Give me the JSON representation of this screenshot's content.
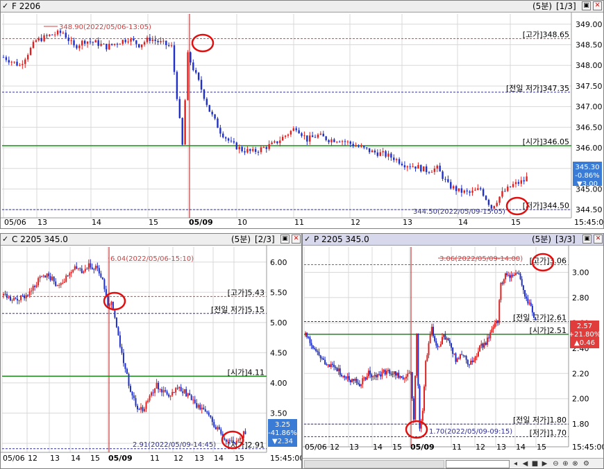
{
  "panels": [
    {
      "id": "F",
      "title": "F 2206",
      "period": "(5분)",
      "page": "[1/3]",
      "chart_data": {
        "type": "candlestick",
        "ylim": [
          344.3,
          349.25
        ],
        "yticks": [
          "349.00",
          "348.50",
          "348.00",
          "347.50",
          "347.00",
          "346.50",
          "346.00",
          "345.50",
          "345.00",
          "344.50"
        ],
        "ytick_values": [
          349.0,
          348.5,
          348.0,
          347.5,
          347.0,
          346.5,
          346.0,
          345.5,
          345.0,
          344.5
        ],
        "xticks": [
          "05/06",
          "13",
          "14",
          "15",
          "05/09",
          "10",
          "11",
          "12",
          "13",
          "14",
          "15",
          "15:45:00"
        ],
        "xtick_bold": "05/09",
        "levels": [
          {
            "label": "[고가]348.65",
            "value": 348.65,
            "style": "dash",
            "color": "#d04040"
          },
          {
            "label": "[전일 저가]347.35",
            "value": 347.35,
            "style": "dash",
            "color": "#303090"
          },
          {
            "label": "[시가]346.05",
            "value": 346.05,
            "style": "solid",
            "color": "#1a8c1a"
          },
          {
            "label": "[저가]344.50",
            "value": 344.5,
            "style": "dash",
            "color": "#303090"
          }
        ],
        "high_annotation": "348.90(2022/05/06-13:05)",
        "low_annotation": "344.50(2022/05/09-15:05)",
        "last_box": {
          "price": "345.30",
          "change_pct": "-0.86%",
          "change": "▼3.00",
          "color": "#3a7bd5"
        },
        "path": [
          [
            0,
            348.2
          ],
          [
            6,
            348.0
          ],
          [
            12,
            348.6
          ],
          [
            18,
            348.75
          ],
          [
            22,
            348.8
          ],
          [
            26,
            348.45
          ],
          [
            30,
            348.6
          ],
          [
            34,
            348.55
          ],
          [
            38,
            348.45
          ],
          [
            42,
            348.55
          ],
          [
            46,
            348.65
          ],
          [
            50,
            348.5
          ],
          [
            54,
            348.65
          ],
          [
            58,
            348.55
          ],
          [
            62,
            348.45
          ],
          [
            66,
            346.05
          ],
          [
            68,
            348.25
          ],
          [
            72,
            347.6
          ],
          [
            76,
            346.9
          ],
          [
            80,
            346.4
          ],
          [
            84,
            346.1
          ],
          [
            88,
            345.95
          ],
          [
            92,
            345.9
          ],
          [
            96,
            346.0
          ],
          [
            100,
            346.1
          ],
          [
            104,
            346.3
          ],
          [
            108,
            346.5
          ],
          [
            112,
            346.2
          ],
          [
            116,
            346.3
          ],
          [
            120,
            346.2
          ],
          [
            124,
            346.2
          ],
          [
            128,
            346.1
          ],
          [
            132,
            346.0
          ],
          [
            136,
            345.9
          ],
          [
            140,
            345.85
          ],
          [
            144,
            345.75
          ],
          [
            148,
            345.6
          ],
          [
            152,
            345.55
          ],
          [
            156,
            345.45
          ],
          [
            160,
            345.5
          ],
          [
            164,
            345.1
          ],
          [
            168,
            344.95
          ],
          [
            172,
            344.9
          ],
          [
            176,
            345.0
          ],
          [
            180,
            344.55
          ],
          [
            184,
            344.9
          ],
          [
            188,
            345.1
          ],
          [
            192,
            345.2
          ],
          [
            194,
            345.35
          ]
        ],
        "x_total": 210,
        "markers": [
          "high-f",
          "low-f"
        ]
      }
    },
    {
      "id": "C",
      "title": "C 2205 345.0",
      "period": "(5분)",
      "page": "[2/3]",
      "chart_data": {
        "type": "candlestick",
        "ylim": [
          2.85,
          6.25
        ],
        "yticks": [
          "6.00",
          "5.50",
          "5.00",
          "4.50",
          "4.00",
          "3.50",
          "3.00"
        ],
        "ytick_values": [
          6.0,
          5.5,
          5.0,
          4.5,
          4.0,
          3.5,
          3.0
        ],
        "xticks": [
          "05/06",
          "12",
          "13",
          "14",
          "15",
          "05/09",
          "11",
          "12",
          "13",
          "14",
          "15",
          "15:45:00"
        ],
        "xtick_bold": "05/09",
        "levels": [
          {
            "label": "[고가]5.43",
            "value": 5.43,
            "style": "dash",
            "color": "#d04040"
          },
          {
            "label": "[전일 저가]5.15",
            "value": 5.15,
            "style": "dash",
            "color": "#303090"
          },
          {
            "label": "[시가]4.11",
            "value": 4.11,
            "style": "solid",
            "color": "#1a8c1a"
          },
          {
            "label": "[저가]2.91",
            "value": 2.91,
            "style": "dash",
            "color": "#303090"
          }
        ],
        "high_annotation": "6.04(2022/05/06-15:10)",
        "low_annotation": "2.91(2022/05/09-14:45)",
        "last_box": {
          "price": "3.25",
          "change_pct": "-41.86%",
          "change": "▼2.34",
          "color": "#3a7bd5"
        },
        "path": [
          [
            0,
            5.45
          ],
          [
            5,
            5.35
          ],
          [
            10,
            5.4
          ],
          [
            15,
            5.5
          ],
          [
            20,
            5.7
          ],
          [
            25,
            5.8
          ],
          [
            30,
            5.65
          ],
          [
            35,
            5.7
          ],
          [
            40,
            5.9
          ],
          [
            45,
            5.85
          ],
          [
            50,
            5.95
          ],
          [
            55,
            5.85
          ],
          [
            58,
            5.6
          ],
          [
            60,
            5.3
          ],
          [
            62,
            5.35
          ],
          [
            65,
            4.9
          ],
          [
            68,
            4.5
          ],
          [
            71,
            4.1
          ],
          [
            74,
            3.8
          ],
          [
            77,
            3.6
          ],
          [
            80,
            3.55
          ],
          [
            84,
            3.8
          ],
          [
            88,
            3.95
          ],
          [
            92,
            3.85
          ],
          [
            96,
            3.8
          ],
          [
            100,
            3.9
          ],
          [
            104,
            3.85
          ],
          [
            108,
            3.75
          ],
          [
            112,
            3.6
          ],
          [
            116,
            3.5
          ],
          [
            120,
            3.35
          ],
          [
            124,
            3.2
          ],
          [
            128,
            3.05
          ],
          [
            132,
            3.0
          ],
          [
            136,
            3.1
          ],
          [
            140,
            3.2
          ]
        ],
        "x_total": 152,
        "markers": [
          "high-c",
          "low-c"
        ]
      }
    },
    {
      "id": "P",
      "title": "P 2205 345.0",
      "period": "(5분)",
      "page": "[3/3]",
      "chart_data": {
        "type": "candlestick",
        "ylim": [
          1.62,
          3.2
        ],
        "yticks": [
          "3.00",
          "2.80",
          "2.60",
          "2.40",
          "2.20",
          "2.00",
          "1.80"
        ],
        "ytick_values": [
          3.0,
          2.8,
          2.6,
          2.4,
          2.2,
          2.0,
          1.8
        ],
        "xticks": [
          "05/06",
          "12",
          "13",
          "14",
          "15",
          "05/09",
          "11",
          "12",
          "13",
          "14",
          "15",
          "15:45:00"
        ],
        "xtick_bold": "05/09",
        "levels": [
          {
            "label": "[고가]3.06",
            "value": 3.06,
            "style": "dash",
            "color": "#d04040"
          },
          {
            "label": "[시가]2.51",
            "value": 2.51,
            "style": "solid",
            "color": "#1a8c1a"
          },
          {
            "label": "[전일 고가]2.61",
            "value": 2.61,
            "style": "dash",
            "color": "#303090"
          },
          {
            "label": "[전일 저가]1.80",
            "value": 1.8,
            "style": "dash",
            "color": "#303090"
          },
          {
            "label": "[저가]1.70",
            "value": 1.7,
            "style": "dash",
            "color": "#303090"
          }
        ],
        "high_annotation": "3.06(2022/05/09-14:00)",
        "low_annotation": "1.70(2022/05/09-09:15)",
        "last_box": {
          "price": "2.57",
          "change_pct": "+21.80%",
          "change": "▲0.46",
          "color": "#e03c3c"
        },
        "path": [
          [
            0,
            2.5
          ],
          [
            6,
            2.4
          ],
          [
            12,
            2.3
          ],
          [
            18,
            2.25
          ],
          [
            24,
            2.2
          ],
          [
            30,
            2.15
          ],
          [
            36,
            2.12
          ],
          [
            42,
            2.2
          ],
          [
            48,
            2.18
          ],
          [
            54,
            2.22
          ],
          [
            60,
            2.2
          ],
          [
            66,
            2.15
          ],
          [
            70,
            2.2
          ],
          [
            72,
            1.85
          ],
          [
            74,
            2.5
          ],
          [
            76,
            1.75
          ],
          [
            78,
            1.9
          ],
          [
            80,
            2.3
          ],
          [
            84,
            2.55
          ],
          [
            88,
            2.4
          ],
          [
            92,
            2.5
          ],
          [
            96,
            2.45
          ],
          [
            100,
            2.3
          ],
          [
            104,
            2.35
          ],
          [
            108,
            2.28
          ],
          [
            112,
            2.3
          ],
          [
            116,
            2.4
          ],
          [
            120,
            2.45
          ],
          [
            124,
            2.55
          ],
          [
            128,
            2.62
          ],
          [
            130,
            2.9
          ],
          [
            134,
            3.0
          ],
          [
            138,
            2.95
          ],
          [
            142,
            3.0
          ],
          [
            146,
            2.8
          ],
          [
            150,
            2.72
          ],
          [
            154,
            2.57
          ]
        ],
        "x_total": 176,
        "markers": [
          "high-p",
          "low-p"
        ]
      }
    }
  ],
  "scroll_icons": [
    "first-icon",
    "prev-icon",
    "stop-icon",
    "play-icon",
    "zoom-out-icon",
    "zoom-in-icon",
    "zoom-fit-icon",
    "settings-icon"
  ],
  "colors": {
    "up": "#e02020",
    "down": "#1f2fc8",
    "grid": "#d8d8d8",
    "open_line": "#1a8c1a",
    "vline": "#c01010",
    "circle": "#e01010"
  }
}
